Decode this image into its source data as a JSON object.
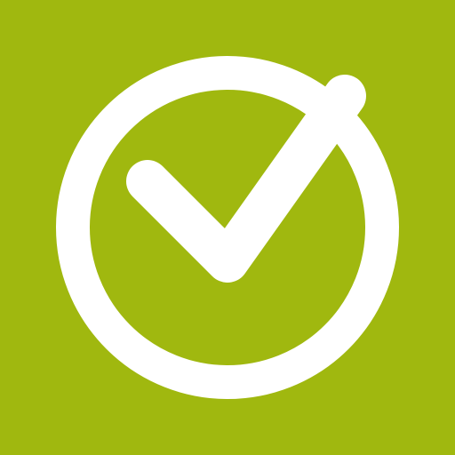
{
  "icon": {
    "name": "check-circle-icon",
    "colors": {
      "background": "#a0b80f",
      "foreground": "#ffffff"
    }
  }
}
